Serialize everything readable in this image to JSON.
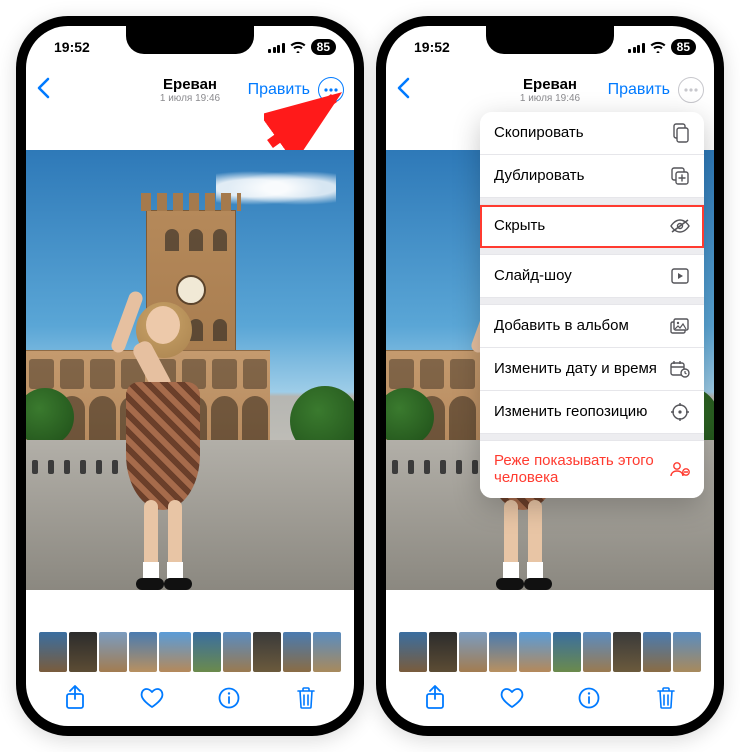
{
  "status": {
    "time": "19:52",
    "battery": "85"
  },
  "nav": {
    "location": "Ереван",
    "subtitle": "1 июля  19:46",
    "edit": "Править"
  },
  "menu": {
    "copy": "Скопировать",
    "duplicate": "Дублировать",
    "hide": "Скрыть",
    "slideshow": "Слайд-шоу",
    "add_album": "Добавить в альбом",
    "adjust_datetime": "Изменить дату и время",
    "adjust_location": "Изменить геопозицию",
    "feature_less": "Реже показывать этого человека"
  }
}
